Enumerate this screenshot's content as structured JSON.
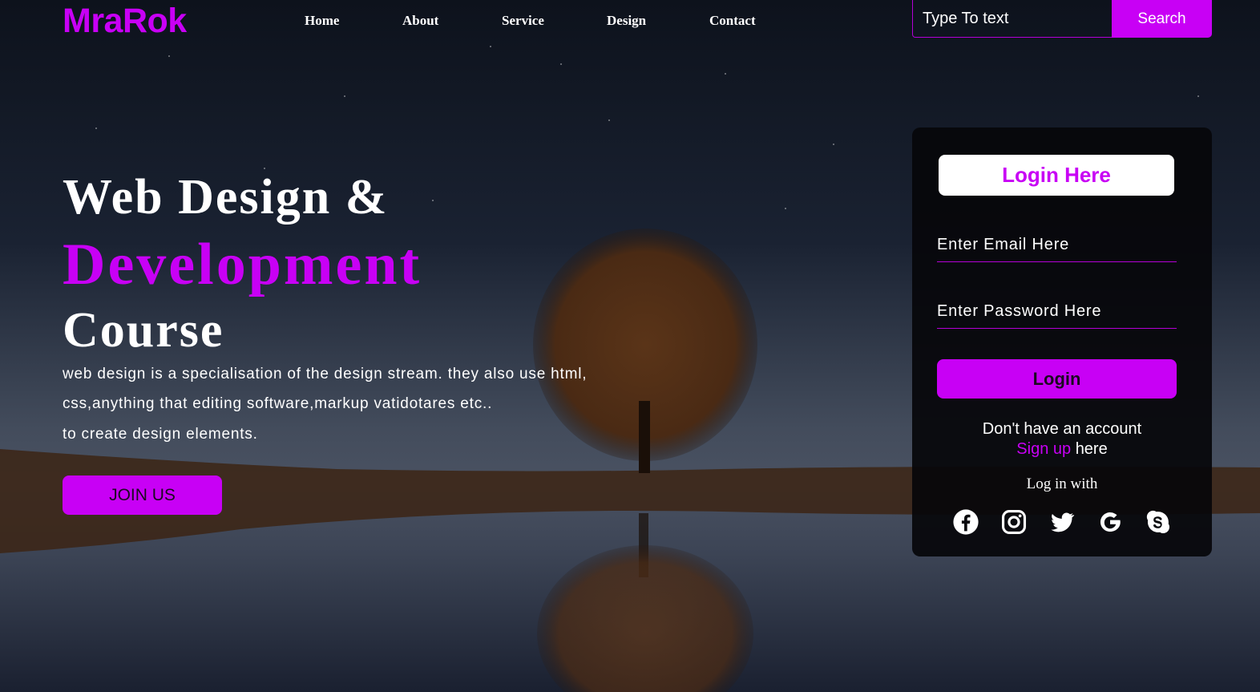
{
  "brand": {
    "logo": "MraRok",
    "accent": "#c800f5"
  },
  "nav": {
    "items": [
      "Home",
      "About",
      "Service",
      "Design",
      "Contact"
    ]
  },
  "search": {
    "placeholder": "Type To text",
    "button_label": "Search"
  },
  "hero": {
    "line1": "Web Design &",
    "line2": "Development",
    "line3": "Course",
    "description": [
      "web design is a specialisation of the design stream. they also use html,",
      "css,anything that editing software,markup vatidotares etc..",
      "to create design elements."
    ],
    "cta_label": "JOIN US"
  },
  "login_panel": {
    "title": "Login Here",
    "email_placeholder": "Enter Email Here",
    "password_placeholder": "Enter Password Here",
    "login_button": "Login",
    "no_account_text": "Don't have an account",
    "signup_link": "Sign up",
    "signup_suffix": "here",
    "login_with": "Log in with",
    "social_icons": [
      "facebook-icon",
      "instagram-icon",
      "twitter-icon",
      "google-icon",
      "skype-icon"
    ]
  }
}
